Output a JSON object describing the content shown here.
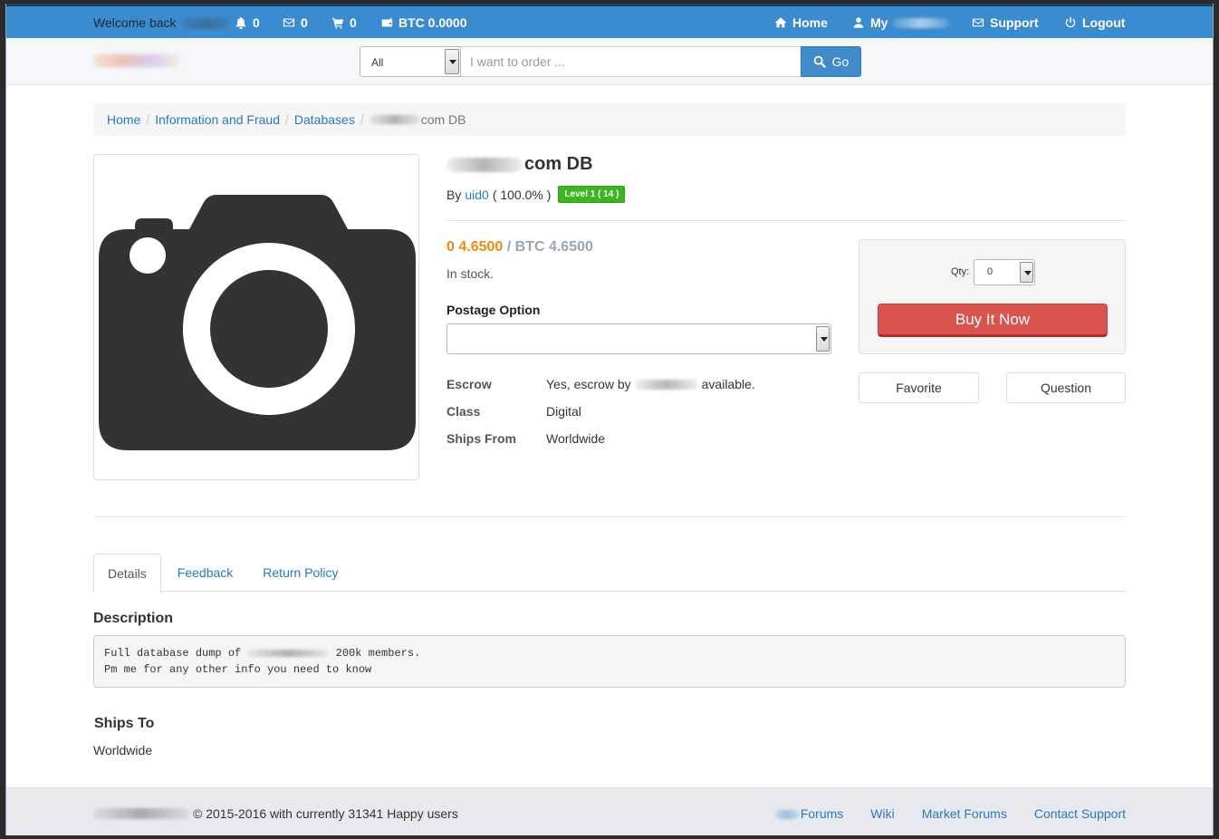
{
  "topbar": {
    "welcome": "Welcome back",
    "notifications_count": "0",
    "messages_count": "0",
    "cart_count": "0",
    "wallet": "BTC 0.0000",
    "home": "Home",
    "my": "My",
    "support": "Support",
    "logout": "Logout"
  },
  "search": {
    "category": "All",
    "placeholder": "I want to order ...",
    "go": "Go"
  },
  "breadcrumb": {
    "home": "Home",
    "category": "Information and Fraud",
    "subcategory": "Databases",
    "current": "com DB"
  },
  "product": {
    "title": "com DB",
    "by_label": "By",
    "vendor": "uid0",
    "rating": "( 100.0% )",
    "level": "Level 1 ( 14 )",
    "price_primary": "0 4.6500",
    "price_secondary": "/ BTC 4.6500",
    "stock": "In stock.",
    "postage_label": "Postage Option",
    "attributes": [
      {
        "key": "Escrow",
        "value_prefix": "Yes, escrow by",
        "value_suffix": "available."
      },
      {
        "key": "Class",
        "value": "Digital"
      },
      {
        "key": "Ships From",
        "value": "Worldwide"
      }
    ]
  },
  "buy": {
    "qty_label": "Qty:",
    "qty_value": "0",
    "buy_now": "Buy It Now",
    "favorite": "Favorite",
    "question": "Question"
  },
  "tabs": [
    {
      "label": "Details",
      "active": true
    },
    {
      "label": "Feedback"
    },
    {
      "label": "Return Policy"
    }
  ],
  "description": {
    "title": "Description",
    "line1_prefix": "Full database dump of ",
    "line1_suffix": " 200k members.",
    "line2": "Pm me for any other info you need to know"
  },
  "ships_to": {
    "title": "Ships To",
    "value": "Worldwide"
  },
  "footer": {
    "copyright": "© 2015-2016 with currently 31341 Happy users",
    "links": [
      "Forums",
      "Wiki",
      "Market Forums",
      "Contact Support"
    ]
  },
  "colors": {
    "topbar": "#3a8bcf",
    "price": "#f08a12",
    "buy_button": "#d9534f",
    "level_badge": "#3cb521",
    "link": "#2a7ab8"
  }
}
